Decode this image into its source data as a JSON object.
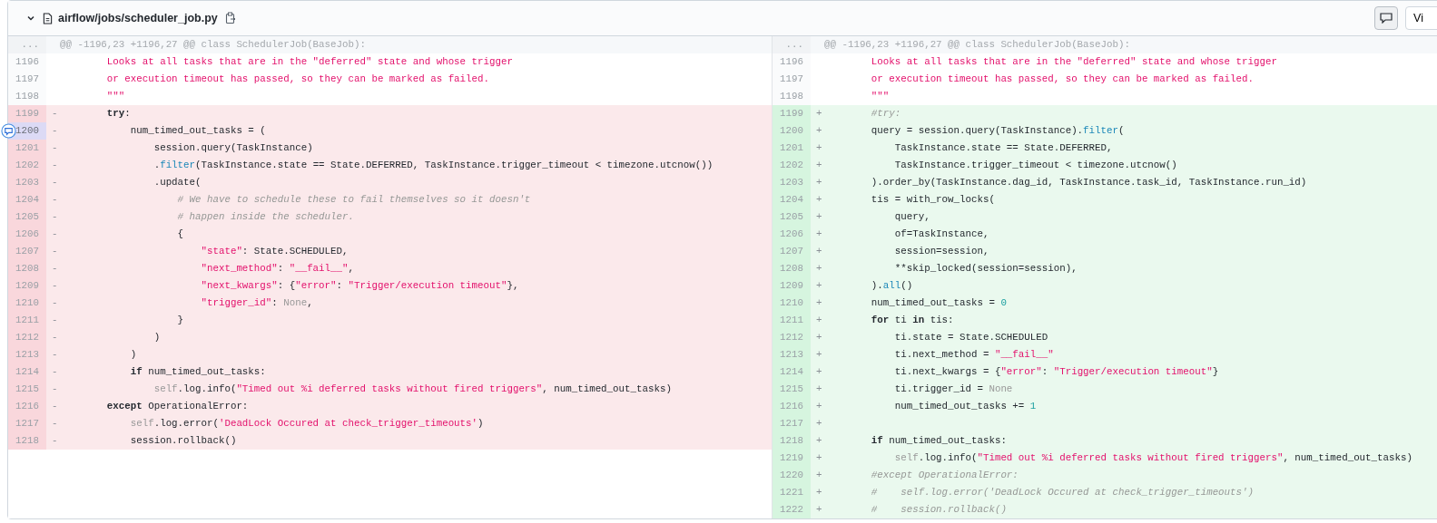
{
  "file": {
    "path": "airflow/jobs/scheduler_job.py",
    "expanded": true
  },
  "toolbar": {
    "comment_toggle": {
      "selected": true
    },
    "view_button": {
      "label": "Vi"
    }
  },
  "hunk": {
    "left": {
      "marker": "...",
      "header": "@@ -1196,23 +1196,27 @@ class SchedulerJob(BaseJob):"
    },
    "right": {
      "marker": "...",
      "header": "@@ -1196,23 +1196,27 @@ class SchedulerJob(BaseJob):"
    }
  },
  "rows": [
    {
      "left": {
        "kind": "context",
        "number": "1196",
        "tokens": [
          {
            "kind": "string",
            "text": "        Looks at all tasks that are in the \"deferred\" state and whose trigger"
          }
        ]
      },
      "right": {
        "kind": "context",
        "number": "1196",
        "tokens": [
          {
            "kind": "string",
            "text": "        Looks at all tasks that are in the \"deferred\" state and whose trigger"
          }
        ]
      }
    },
    {
      "left": {
        "kind": "context",
        "number": "1197",
        "tokens": [
          {
            "kind": "string",
            "text": "        or execution timeout has passed, so they can be marked as failed."
          }
        ]
      },
      "right": {
        "kind": "context",
        "number": "1197",
        "tokens": [
          {
            "kind": "string",
            "text": "        or execution timeout has passed, so they can be marked as failed."
          }
        ]
      }
    },
    {
      "left": {
        "kind": "context",
        "number": "1198",
        "tokens": [
          {
            "kind": "string",
            "text": "        \"\"\""
          }
        ]
      },
      "right": {
        "kind": "context",
        "number": "1198",
        "tokens": [
          {
            "kind": "string",
            "text": "        \"\"\""
          }
        ]
      }
    },
    {
      "left": {
        "kind": "deletion",
        "number": "1199",
        "sign": "-",
        "tokens": [
          {
            "kind": "keyword",
            "text": "        try"
          },
          {
            "kind": "plain",
            "text": ":"
          }
        ]
      },
      "right": {
        "kind": "addition",
        "number": "1199",
        "sign": "+",
        "tokens": [
          {
            "kind": "comment",
            "text": "        #try:"
          }
        ]
      }
    },
    {
      "left": {
        "kind": "deletion",
        "number": "1200",
        "sign": "-",
        "comment_hover": true,
        "tokens": [
          {
            "kind": "plain",
            "text": "            num_timed_out_tasks = ("
          }
        ]
      },
      "right": {
        "kind": "addition",
        "number": "1200",
        "sign": "+",
        "tokens": [
          {
            "kind": "plain",
            "text": "        query = session.query(TaskInstance)."
          },
          {
            "kind": "builtin",
            "text": "filter"
          },
          {
            "kind": "plain",
            "text": "("
          }
        ]
      }
    },
    {
      "left": {
        "kind": "deletion",
        "number": "1201",
        "sign": "-",
        "tokens": [
          {
            "kind": "plain",
            "text": "                session.query(TaskInstance)"
          }
        ]
      },
      "right": {
        "kind": "addition",
        "number": "1201",
        "sign": "+",
        "tokens": [
          {
            "kind": "plain",
            "text": "            TaskInstance.state == State.DEFERRED,"
          }
        ]
      }
    },
    {
      "left": {
        "kind": "deletion",
        "number": "1202",
        "sign": "-",
        "tokens": [
          {
            "kind": "plain",
            "text": "                ."
          },
          {
            "kind": "builtin",
            "text": "filter"
          },
          {
            "kind": "plain",
            "text": "(TaskInstance.state == State.DEFERRED, TaskInstance.trigger_timeout < timezone.utcnow())"
          }
        ]
      },
      "right": {
        "kind": "addition",
        "number": "1202",
        "sign": "+",
        "tokens": [
          {
            "kind": "plain",
            "text": "            TaskInstance.trigger_timeout < timezone.utcnow()"
          }
        ]
      }
    },
    {
      "left": {
        "kind": "deletion",
        "number": "1203",
        "sign": "-",
        "tokens": [
          {
            "kind": "plain",
            "text": "                .update("
          }
        ]
      },
      "right": {
        "kind": "addition",
        "number": "1203",
        "sign": "+",
        "tokens": [
          {
            "kind": "plain",
            "text": "        ).order_by(TaskInstance.dag_id, TaskInstance.task_id, TaskInstance.run_id)"
          }
        ]
      }
    },
    {
      "left": {
        "kind": "deletion",
        "number": "1204",
        "sign": "-",
        "tokens": [
          {
            "kind": "comment",
            "text": "                    # We have to schedule these to fail themselves so it doesn't"
          }
        ]
      },
      "right": {
        "kind": "addition",
        "number": "1204",
        "sign": "+",
        "tokens": [
          {
            "kind": "plain",
            "text": "        tis = with_row_locks("
          }
        ]
      }
    },
    {
      "left": {
        "kind": "deletion",
        "number": "1205",
        "sign": "-",
        "tokens": [
          {
            "kind": "comment",
            "text": "                    # happen inside the scheduler."
          }
        ]
      },
      "right": {
        "kind": "addition",
        "number": "1205",
        "sign": "+",
        "tokens": [
          {
            "kind": "plain",
            "text": "            query,"
          }
        ]
      }
    },
    {
      "left": {
        "kind": "deletion",
        "number": "1206",
        "sign": "-",
        "tokens": [
          {
            "kind": "plain",
            "text": "                    {"
          }
        ]
      },
      "right": {
        "kind": "addition",
        "number": "1206",
        "sign": "+",
        "tokens": [
          {
            "kind": "plain",
            "text": "            of=TaskInstance,"
          }
        ]
      }
    },
    {
      "left": {
        "kind": "deletion",
        "number": "1207",
        "sign": "-",
        "tokens": [
          {
            "kind": "string",
            "text": "                        \"state\""
          },
          {
            "kind": "plain",
            "text": ": State.SCHEDULED,"
          }
        ]
      },
      "right": {
        "kind": "addition",
        "number": "1207",
        "sign": "+",
        "tokens": [
          {
            "kind": "plain",
            "text": "            session=session,"
          }
        ]
      }
    },
    {
      "left": {
        "kind": "deletion",
        "number": "1208",
        "sign": "-",
        "tokens": [
          {
            "kind": "string",
            "text": "                        \"next_method\""
          },
          {
            "kind": "plain",
            "text": ": "
          },
          {
            "kind": "string",
            "text": "\"__fail__\""
          },
          {
            "kind": "plain",
            "text": ","
          }
        ]
      },
      "right": {
        "kind": "addition",
        "number": "1208",
        "sign": "+",
        "tokens": [
          {
            "kind": "plain",
            "text": "            **skip_locked(session=session),"
          }
        ]
      }
    },
    {
      "left": {
        "kind": "deletion",
        "number": "1209",
        "sign": "-",
        "tokens": [
          {
            "kind": "string",
            "text": "                        \"next_kwargs\""
          },
          {
            "kind": "plain",
            "text": ": {"
          },
          {
            "kind": "string",
            "text": "\"error\""
          },
          {
            "kind": "plain",
            "text": ": "
          },
          {
            "kind": "string",
            "text": "\"Trigger/execution timeout\""
          },
          {
            "kind": "plain",
            "text": "},"
          }
        ]
      },
      "right": {
        "kind": "addition",
        "number": "1209",
        "sign": "+",
        "tokens": [
          {
            "kind": "plain",
            "text": "        )."
          },
          {
            "kind": "builtin",
            "text": "all"
          },
          {
            "kind": "plain",
            "text": "()"
          }
        ]
      }
    },
    {
      "left": {
        "kind": "deletion",
        "number": "1210",
        "sign": "-",
        "tokens": [
          {
            "kind": "string",
            "text": "                        \"trigger_id\""
          },
          {
            "kind": "plain",
            "text": ": "
          },
          {
            "kind": "constant",
            "text": "None"
          },
          {
            "kind": "plain",
            "text": ","
          }
        ]
      },
      "right": {
        "kind": "addition",
        "number": "1210",
        "sign": "+",
        "tokens": [
          {
            "kind": "plain",
            "text": "        num_timed_out_tasks = "
          },
          {
            "kind": "number",
            "text": "0"
          }
        ]
      }
    },
    {
      "left": {
        "kind": "deletion",
        "number": "1211",
        "sign": "-",
        "tokens": [
          {
            "kind": "plain",
            "text": "                    }"
          }
        ]
      },
      "right": {
        "kind": "addition",
        "number": "1211",
        "sign": "+",
        "tokens": [
          {
            "kind": "keyword",
            "text": "        for"
          },
          {
            "kind": "plain",
            "text": " ti "
          },
          {
            "kind": "keyword",
            "text": "in"
          },
          {
            "kind": "plain",
            "text": " tis:"
          }
        ]
      }
    },
    {
      "left": {
        "kind": "deletion",
        "number": "1212",
        "sign": "-",
        "tokens": [
          {
            "kind": "plain",
            "text": "                )"
          }
        ]
      },
      "right": {
        "kind": "addition",
        "number": "1212",
        "sign": "+",
        "tokens": [
          {
            "kind": "plain",
            "text": "            ti.state = State.SCHEDULED"
          }
        ]
      }
    },
    {
      "left": {
        "kind": "deletion",
        "number": "1213",
        "sign": "-",
        "tokens": [
          {
            "kind": "plain",
            "text": "            )"
          }
        ]
      },
      "right": {
        "kind": "addition",
        "number": "1213",
        "sign": "+",
        "tokens": [
          {
            "kind": "plain",
            "text": "            ti.next_method = "
          },
          {
            "kind": "string",
            "text": "\"__fail__\""
          }
        ]
      }
    },
    {
      "left": {
        "kind": "deletion",
        "number": "1214",
        "sign": "-",
        "tokens": [
          {
            "kind": "keyword",
            "text": "            if"
          },
          {
            "kind": "plain",
            "text": " num_timed_out_tasks:"
          }
        ]
      },
      "right": {
        "kind": "addition",
        "number": "1214",
        "sign": "+",
        "tokens": [
          {
            "kind": "plain",
            "text": "            ti.next_kwargs = {"
          },
          {
            "kind": "string",
            "text": "\"error\""
          },
          {
            "kind": "plain",
            "text": ": "
          },
          {
            "kind": "string",
            "text": "\"Trigger/execution timeout\""
          },
          {
            "kind": "plain",
            "text": "}"
          }
        ]
      }
    },
    {
      "left": {
        "kind": "deletion",
        "number": "1215",
        "sign": "-",
        "tokens": [
          {
            "kind": "constant",
            "text": "                self"
          },
          {
            "kind": "plain",
            "text": ".log.info("
          },
          {
            "kind": "string",
            "text": "\"Timed out %i deferred tasks without fired triggers\""
          },
          {
            "kind": "plain",
            "text": ", num_timed_out_tasks)"
          }
        ]
      },
      "right": {
        "kind": "addition",
        "number": "1215",
        "sign": "+",
        "tokens": [
          {
            "kind": "plain",
            "text": "            ti.trigger_id = "
          },
          {
            "kind": "constant",
            "text": "None"
          }
        ]
      }
    },
    {
      "left": {
        "kind": "deletion",
        "number": "1216",
        "sign": "-",
        "tokens": [
          {
            "kind": "keyword",
            "text": "        except"
          },
          {
            "kind": "plain",
            "text": " OperationalError:"
          }
        ]
      },
      "right": {
        "kind": "addition",
        "number": "1216",
        "sign": "+",
        "tokens": [
          {
            "kind": "plain",
            "text": "            num_timed_out_tasks += "
          },
          {
            "kind": "number",
            "text": "1"
          }
        ]
      }
    },
    {
      "left": {
        "kind": "deletion",
        "number": "1217",
        "sign": "-",
        "tokens": [
          {
            "kind": "constant",
            "text": "            self"
          },
          {
            "kind": "plain",
            "text": ".log.error("
          },
          {
            "kind": "string",
            "text": "'DeadLock Occured at check_trigger_timeouts'"
          },
          {
            "kind": "plain",
            "text": ")"
          }
        ]
      },
      "right": {
        "kind": "addition",
        "number": "1217",
        "sign": "+"
      }
    },
    {
      "left": {
        "kind": "deletion",
        "number": "1218",
        "sign": "-",
        "tokens": [
          {
            "kind": "plain",
            "text": "            session.rollback()"
          }
        ]
      },
      "right": {
        "kind": "addition",
        "number": "1218",
        "sign": "+",
        "tokens": [
          {
            "kind": "keyword",
            "text": "        if"
          },
          {
            "kind": "plain",
            "text": " num_timed_out_tasks:"
          }
        ]
      }
    },
    {
      "left": {
        "kind": "empty"
      },
      "right": {
        "kind": "addition",
        "number": "1219",
        "sign": "+",
        "tokens": [
          {
            "kind": "constant",
            "text": "            self"
          },
          {
            "kind": "plain",
            "text": ".log.info("
          },
          {
            "kind": "string",
            "text": "\"Timed out %i deferred tasks without fired triggers\""
          },
          {
            "kind": "plain",
            "text": ", num_timed_out_tasks)"
          }
        ]
      }
    },
    {
      "left": {
        "kind": "empty"
      },
      "right": {
        "kind": "addition",
        "number": "1220",
        "sign": "+",
        "tokens": [
          {
            "kind": "comment",
            "text": "        #except OperationalError:"
          }
        ]
      }
    },
    {
      "left": {
        "kind": "empty"
      },
      "right": {
        "kind": "addition",
        "number": "1221",
        "sign": "+",
        "tokens": [
          {
            "kind": "comment",
            "text": "        #    self.log.error('DeadLock Occured at check_trigger_timeouts')"
          }
        ]
      }
    },
    {
      "left": {
        "kind": "empty"
      },
      "right": {
        "kind": "addition",
        "number": "1222",
        "sign": "+",
        "tokens": [
          {
            "kind": "comment",
            "text": "        #    session.rollback()"
          }
        ]
      }
    }
  ]
}
